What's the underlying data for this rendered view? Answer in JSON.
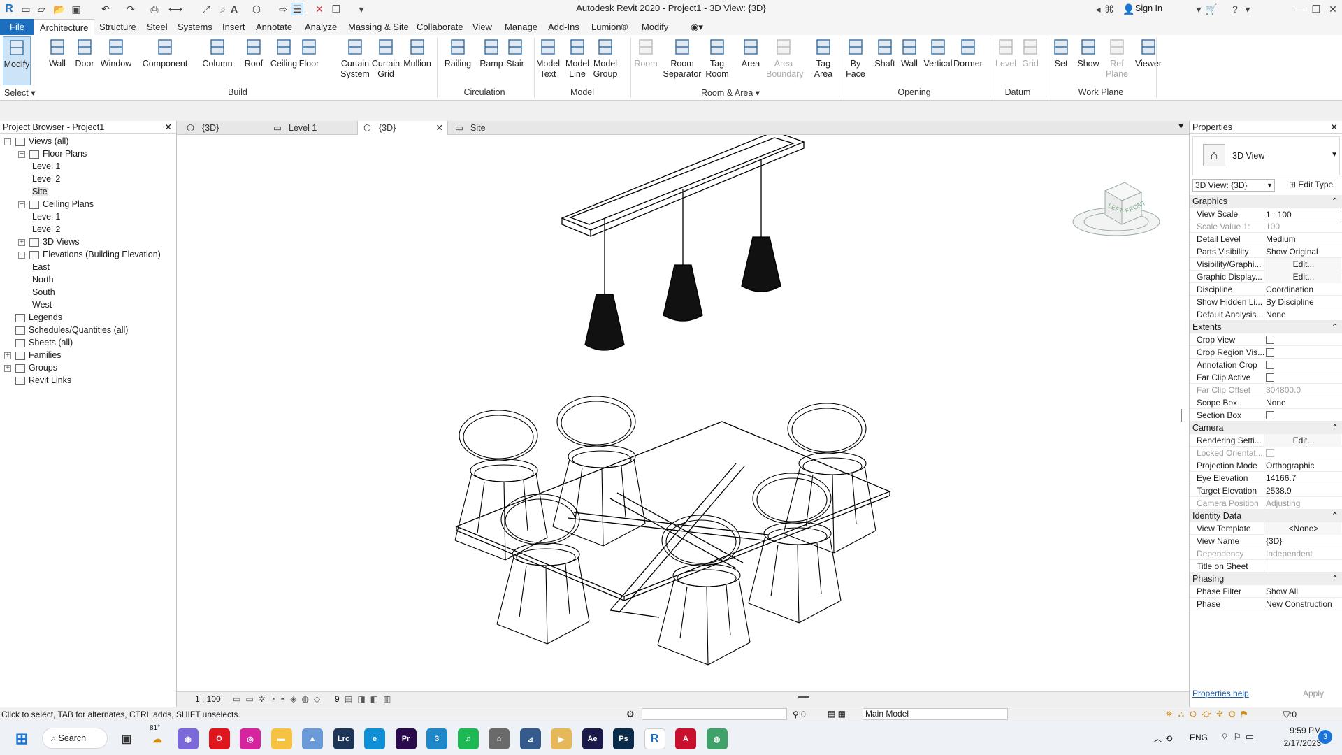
{
  "window": {
    "title": "Autodesk Revit 2020 - Project1 - 3D View: {3D}",
    "sign_in": "Sign In"
  },
  "menu_tabs": [
    "File",
    "Architecture",
    "Structure",
    "Steel",
    "Systems",
    "Insert",
    "Annotate",
    "Analyze",
    "Massing & Site",
    "Collaborate",
    "View",
    "Manage",
    "Add-Ins",
    "Lumion®",
    "Modify"
  ],
  "ribbon": {
    "select_label": "Select",
    "tools": [
      {
        "label": "Modify",
        "icon": "cursor-icon"
      },
      {
        "label": "Wall",
        "icon": "wall-icon"
      },
      {
        "label": "Door",
        "icon": "door-icon"
      },
      {
        "label": "Window",
        "icon": "window-icon"
      },
      {
        "label": "Component",
        "icon": "component-icon"
      },
      {
        "label": "Column",
        "icon": "column-icon"
      },
      {
        "label": "Roof",
        "icon": "roof-icon"
      },
      {
        "label": "Ceiling",
        "icon": "ceiling-icon"
      },
      {
        "label": "Floor",
        "icon": "floor-icon"
      },
      {
        "label": "Curtain System",
        "icon": "curtain-system-icon"
      },
      {
        "label": "Curtain Grid",
        "icon": "curtain-grid-icon"
      },
      {
        "label": "Mullion",
        "icon": "mullion-icon"
      },
      {
        "label": "Railing",
        "icon": "railing-icon"
      },
      {
        "label": "Ramp",
        "icon": "ramp-icon"
      },
      {
        "label": "Stair",
        "icon": "stair-icon"
      },
      {
        "label": "Model Text",
        "icon": "model-text-icon"
      },
      {
        "label": "Model Line",
        "icon": "model-line-icon"
      },
      {
        "label": "Model Group",
        "icon": "model-group-icon"
      },
      {
        "label": "Room",
        "icon": "room-icon"
      },
      {
        "label": "Room Separator",
        "icon": "room-separator-icon"
      },
      {
        "label": "Tag Room",
        "icon": "tag-room-icon"
      },
      {
        "label": "Area",
        "icon": "area-icon"
      },
      {
        "label": "Area Boundary",
        "icon": "area-boundary-icon"
      },
      {
        "label": "Tag Area",
        "icon": "tag-area-icon"
      },
      {
        "label": "By Face",
        "icon": "by-face-icon"
      },
      {
        "label": "Shaft",
        "icon": "shaft-icon"
      },
      {
        "label": "Wall",
        "icon": "wall-opening-icon"
      },
      {
        "label": "Vertical",
        "icon": "vertical-icon"
      },
      {
        "label": "Dormer",
        "icon": "dormer-icon"
      },
      {
        "label": "Level",
        "icon": "level-icon"
      },
      {
        "label": "Grid",
        "icon": "grid-icon"
      },
      {
        "label": "Set",
        "icon": "set-icon"
      },
      {
        "label": "Show",
        "icon": "show-icon"
      },
      {
        "label": "Ref Plane",
        "icon": "ref-plane-icon"
      },
      {
        "label": "Viewer",
        "icon": "viewer-icon"
      }
    ],
    "groups": [
      "Build",
      "Circulation",
      "Model",
      "Room & Area",
      "Opening",
      "Datum",
      "Work Plane"
    ]
  },
  "project_browser": {
    "title": "Project Browser - Project1",
    "items": [
      "Views (all)",
      "Floor Plans",
      "Level 1",
      "Level 2",
      "Site",
      "Ceiling Plans",
      "Level 1",
      "Level 2",
      "3D Views",
      "Elevations (Building Elevation)",
      "East",
      "North",
      "South",
      "West",
      "Legends",
      "Schedules/Quantities (all)",
      "Sheets (all)",
      "Families",
      "Groups",
      "Revit Links"
    ]
  },
  "view_tabs": [
    "{3D}",
    "Level 1",
    "{3D}",
    "Site"
  ],
  "viewcube": {
    "left": "LEFT",
    "front": "FRONT"
  },
  "view_control": {
    "scale": "1 : 100",
    "temp_label": "9"
  },
  "properties": {
    "title": "Properties",
    "type_name": "3D View",
    "selector": "3D View: {3D}",
    "edit_type": "Edit Type",
    "sections": {
      "graphics": "Graphics",
      "extents": "Extents",
      "camera": "Camera",
      "identity": "Identity Data",
      "phasing": "Phasing"
    },
    "rows": [
      {
        "k": "View Scale",
        "v": "1 : 100"
      },
      {
        "k": "Scale Value    1:",
        "v": "100"
      },
      {
        "k": "Detail Level",
        "v": "Medium"
      },
      {
        "k": "Parts Visibility",
        "v": "Show Original"
      },
      {
        "k": "Visibility/Graphi...",
        "v": "Edit..."
      },
      {
        "k": "Graphic Display...",
        "v": "Edit..."
      },
      {
        "k": "Discipline",
        "v": "Coordination"
      },
      {
        "k": "Show Hidden Li...",
        "v": "By Discipline"
      },
      {
        "k": "Default Analysis...",
        "v": "None"
      },
      {
        "k": "Crop View",
        "v": ""
      },
      {
        "k": "Crop Region Vis...",
        "v": ""
      },
      {
        "k": "Annotation Crop",
        "v": ""
      },
      {
        "k": "Far Clip Active",
        "v": ""
      },
      {
        "k": "Far Clip Offset",
        "v": "304800.0"
      },
      {
        "k": "Scope Box",
        "v": "None"
      },
      {
        "k": "Section Box",
        "v": ""
      },
      {
        "k": "Rendering Setti...",
        "v": "Edit..."
      },
      {
        "k": "Locked Orientat...",
        "v": ""
      },
      {
        "k": "Projection Mode",
        "v": "Orthographic"
      },
      {
        "k": "Eye Elevation",
        "v": "14166.7"
      },
      {
        "k": "Target Elevation",
        "v": "2538.9"
      },
      {
        "k": "Camera Position",
        "v": "Adjusting"
      },
      {
        "k": "View Template",
        "v": "<None>"
      },
      {
        "k": "View Name",
        "v": "{3D}"
      },
      {
        "k": "Dependency",
        "v": "Independent"
      },
      {
        "k": "Title on Sheet",
        "v": ""
      },
      {
        "k": "Phase Filter",
        "v": "Show All"
      },
      {
        "k": "Phase",
        "v": "New Construction"
      }
    ],
    "help": "Properties help",
    "apply": "Apply"
  },
  "status": {
    "hint": "Click to select, TAB for alternates, CTRL adds, SHIFT unselects.",
    "coord": ":0",
    "model": "Main Model",
    "filter": ":0"
  },
  "taskbar": {
    "search": "Search",
    "weather": "81°",
    "lang": "ENG",
    "time": "9:59 PM",
    "date": "2/17/2023",
    "badge": "3"
  }
}
